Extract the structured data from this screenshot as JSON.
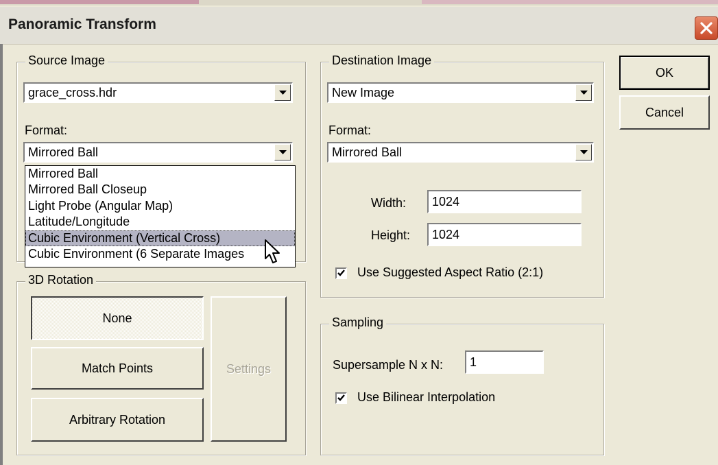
{
  "dialog": {
    "title": "Panoramic Transform"
  },
  "source": {
    "legend": "Source Image",
    "image_value": "grace_cross.hdr",
    "format_label": "Format:",
    "format_value": "Mirrored Ball",
    "format_options": [
      "Mirrored Ball",
      "Mirrored Ball Closeup",
      "Light Probe (Angular Map)",
      "Latitude/Longitude",
      "Cubic Environment (Vertical Cross)",
      "Cubic Environment (6 Separate Images"
    ],
    "highlighted_option": "Cubic Environment (Vertical Cross)"
  },
  "rotation": {
    "legend": "3D Rotation",
    "none_label": "None",
    "match_label": "Match Points",
    "arbitrary_label": "Arbitrary Rotation",
    "settings_label": "Settings"
  },
  "destination": {
    "legend": "Destination Image",
    "image_value": "New Image",
    "format_label": "Format:",
    "format_value": "Mirrored Ball",
    "width_label": "Width:",
    "width_value": "1024",
    "height_label": "Height:",
    "height_value": "1024",
    "aspect_label": "Use Suggested Aspect Ratio (2:1)",
    "aspect_checked": true
  },
  "sampling": {
    "legend": "Sampling",
    "supersample_label": "Supersample N x N:",
    "supersample_value": "1",
    "bilinear_label": "Use Bilinear Interpolation",
    "bilinear_checked": true
  },
  "buttons": {
    "ok": "OK",
    "cancel": "Cancel"
  },
  "icons": {
    "close": "close-icon",
    "dropdown": "chevron-down-icon",
    "check": "checkmark-icon",
    "cursor": "mouse-pointer-icon"
  }
}
